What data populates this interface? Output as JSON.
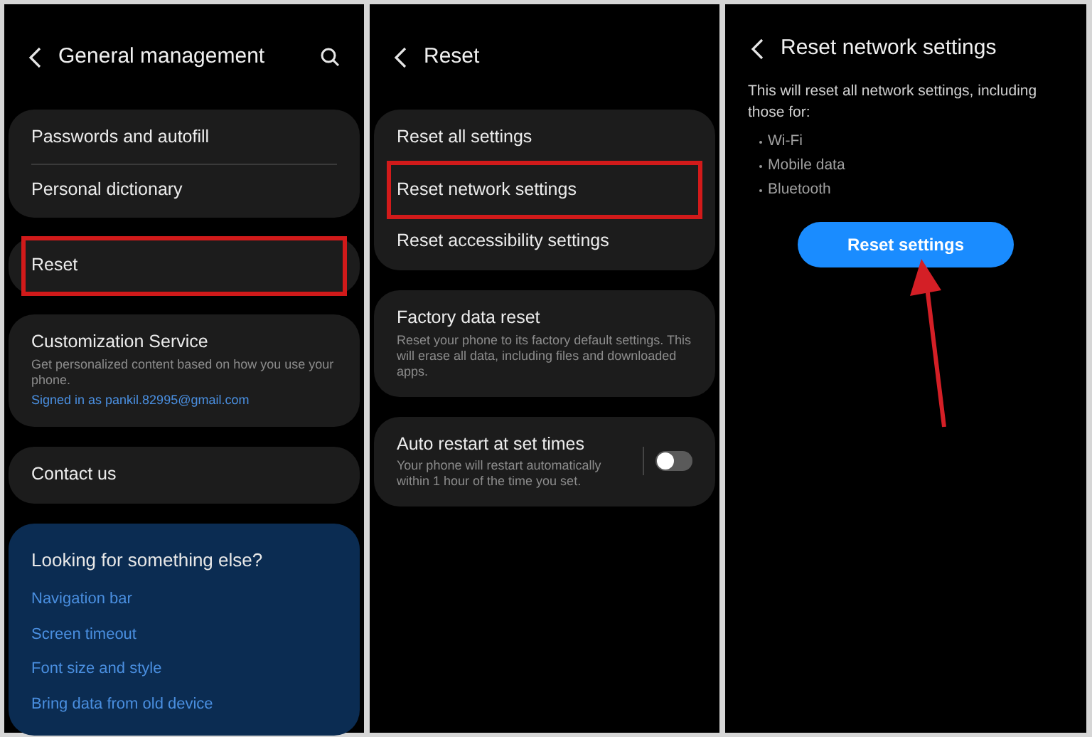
{
  "general_management": {
    "title": "General management",
    "groups": [
      {
        "items": [
          {
            "kind": "text",
            "label": "Passwords and autofill",
            "highlighted": false
          },
          {
            "kind": "text",
            "label": "Personal dictionary",
            "highlighted": false
          }
        ]
      },
      {
        "items": [
          {
            "kind": "text",
            "label": "Reset",
            "highlighted": true
          }
        ]
      },
      {
        "items": [
          {
            "kind": "text",
            "label": "Customization Service",
            "description": "Get personalized content based on how you use your phone.",
            "link": "Signed in as pankil.82995@gmail.com",
            "highlighted": false
          }
        ]
      },
      {
        "items": [
          {
            "kind": "text",
            "label": "Contact us",
            "highlighted": false
          }
        ]
      }
    ],
    "suggestions": {
      "title": "Looking for something else?",
      "links": [
        "Navigation bar",
        "Screen timeout",
        "Font size and style",
        "Bring data from old device"
      ]
    }
  },
  "reset": {
    "title": "Reset",
    "groups": [
      {
        "items": [
          {
            "kind": "text",
            "label": "Reset all settings",
            "highlighted": false
          },
          {
            "kind": "text",
            "label": "Reset network settings",
            "highlighted": true
          },
          {
            "kind": "text",
            "label": "Reset accessibility settings",
            "highlighted": false
          }
        ]
      },
      {
        "items": [
          {
            "kind": "text",
            "label": "Factory data reset",
            "description": "Reset your phone to its factory default settings. This will erase all data, including files and downloaded apps.",
            "highlighted": false
          }
        ]
      },
      {
        "items": [
          {
            "kind": "toggle",
            "label": "Auto restart at set times",
            "description": "Your phone will restart automatically within 1 hour of the time you set.",
            "on": false,
            "highlighted": false
          }
        ]
      }
    ]
  },
  "reset_network": {
    "title": "Reset network settings",
    "description": "This will reset all network settings, including those for:",
    "bullets": [
      "Wi-Fi",
      "Mobile data",
      "Bluetooth"
    ],
    "button": "Reset settings"
  }
}
